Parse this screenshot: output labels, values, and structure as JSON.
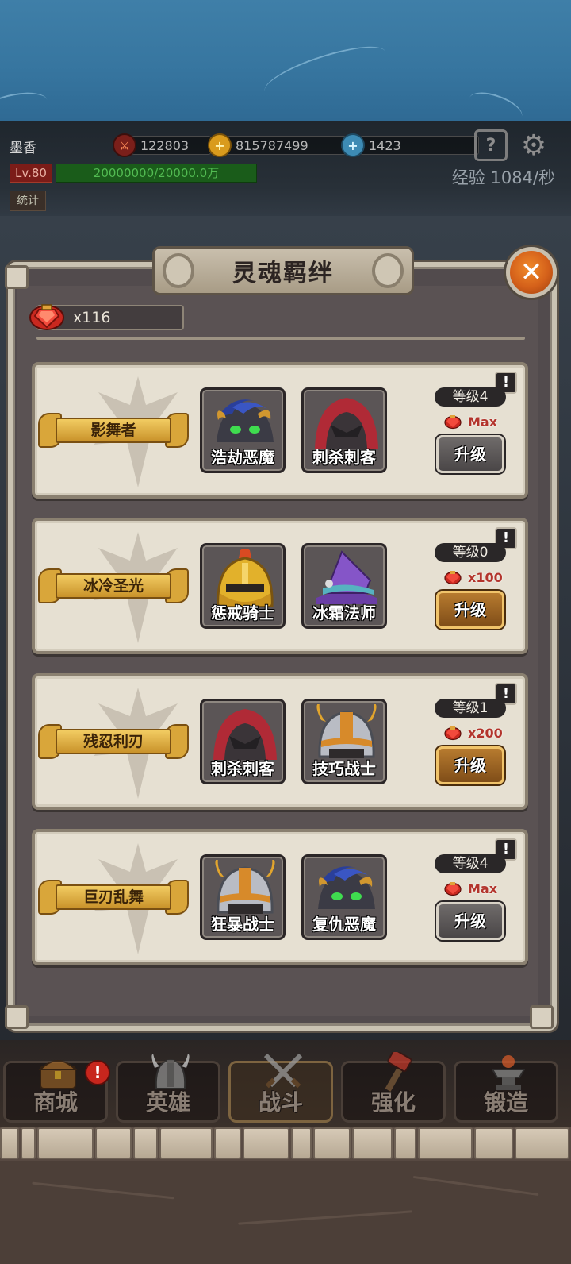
{
  "player": {
    "name": "墨香",
    "level": "Lv.80",
    "exp_text": "20000000/20000.0万",
    "exp_fill": 1.0,
    "exp_rate": "经验 1084/秒",
    "stats_button": "统计",
    "attack": "122803",
    "gold": "815787499",
    "gems": "1423"
  },
  "panel": {
    "title": "灵魂羁绊",
    "currency_count": "x116"
  },
  "bonds": [
    {
      "name": "影舞者",
      "heroes": [
        {
          "name": "浩劫恶魔",
          "art": "demon"
        },
        {
          "name": "刺杀刺客",
          "art": "assassin"
        }
      ],
      "level": "等级4",
      "cost": "Max",
      "upgrade_label": "升级",
      "upgrade_enabled": false
    },
    {
      "name": "冰冷圣光",
      "heroes": [
        {
          "name": "惩戒骑士",
          "art": "knight"
        },
        {
          "name": "冰霜法师",
          "art": "mage"
        }
      ],
      "level": "等级0",
      "cost": "x100",
      "upgrade_label": "升级",
      "upgrade_enabled": true
    },
    {
      "name": "残忍利刃",
      "heroes": [
        {
          "name": "刺杀刺客",
          "art": "assassin"
        },
        {
          "name": "技巧战士",
          "art": "warrior"
        }
      ],
      "level": "等级1",
      "cost": "x200",
      "upgrade_label": "升级",
      "upgrade_enabled": true
    },
    {
      "name": "巨刃乱舞",
      "heroes": [
        {
          "name": "狂暴战士",
          "art": "warrior"
        },
        {
          "name": "复仇恶魔",
          "art": "demon"
        }
      ],
      "level": "等级4",
      "cost": "Max",
      "upgrade_label": "升级",
      "upgrade_enabled": false
    }
  ],
  "nav": [
    {
      "label": "商城",
      "icon": "treasure-chest-icon",
      "badge": "!"
    },
    {
      "label": "英雄",
      "icon": "viking-helmet-icon"
    },
    {
      "label": "战斗",
      "icon": "crossed-swords-icon",
      "active": true
    },
    {
      "label": "强化",
      "icon": "hammer-icon"
    },
    {
      "label": "锻造",
      "icon": "anvil-icon"
    }
  ],
  "colors": {
    "accent_gold": "#f2cc62",
    "close_orange": "#e2701f",
    "max_red": "#b3342c",
    "exp_green": "#1a5c1a"
  }
}
